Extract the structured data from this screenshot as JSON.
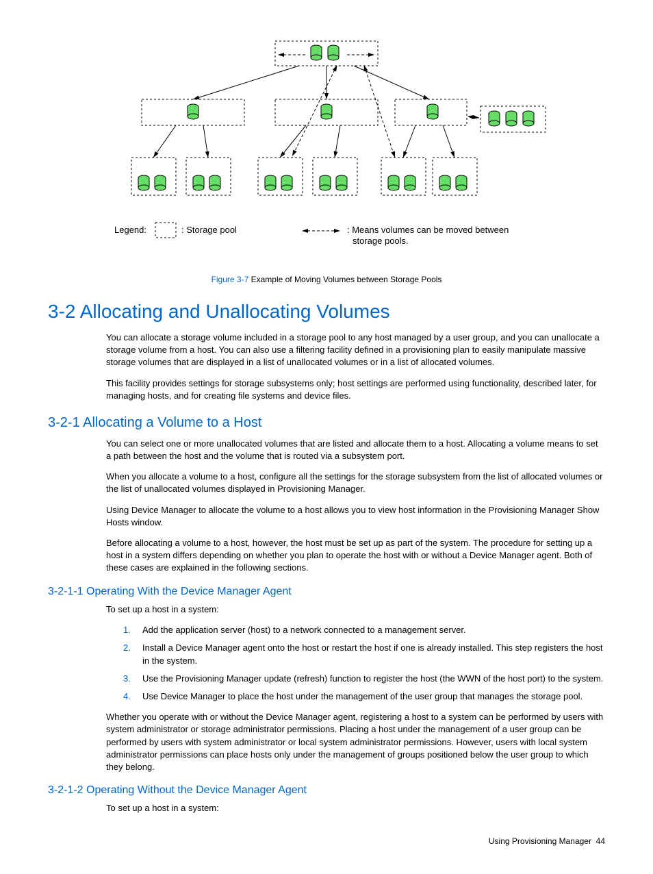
{
  "diagram": {
    "legend_label": "Legend:",
    "storage_pool_label": ": Storage pool",
    "arrow_label": ": Means volumes can be moved between storage pools."
  },
  "caption": {
    "fig": "Figure 3-7",
    "text": " Example of Moving Volumes between Storage Pools"
  },
  "h1": "3-2 Allocating and Unallocating Volumes",
  "p1": "You can allocate a storage volume included in a storage pool to any host managed by a user group, and you can unallocate a storage volume from a host. You can also use a filtering facility defined in a provisioning plan to easily manipulate massive storage volumes that are displayed in a list of unallocated volumes or in a list of allocated volumes.",
  "p2": "This facility provides settings for storage subsystems only; host settings are performed using functionality, described later, for managing hosts, and for creating file systems and device files.",
  "h2a": "3-2-1 Allocating a Volume to a Host",
  "p3": "You can select one or more unallocated volumes that are listed and allocate them to a host. Allocating a volume means to set a path between the host and the volume that is routed via a subsystem port.",
  "p4": "When you allocate a volume to a host, configure all the settings for the storage subsystem from the list of allocated volumes or the list of unallocated volumes displayed in Provisioning Manager.",
  "p5": "Using Device Manager to allocate the volume to a host allows you to view host information in the Provisioning Manager Show Hosts window.",
  "p6": "Before allocating a volume to a host, however, the host must be set up as part of the system. The procedure for setting up a host in a system differs depending on whether you plan to operate the host with or without a Device Manager agent. Both of these cases are explained in the following sections.",
  "h3a": "3-2-1-1 Operating With the Device Manager Agent",
  "p7": "To set up a host in a system:",
  "steps": [
    "Add the application server (host) to a network connected to a management server.",
    "Install a Device Manager agent onto the host or restart the host if one is already installed. This step registers the host in the system.",
    "Use the Provisioning Manager update (refresh) function to register the host (the WWN of the host port) to the system.",
    "Use Device Manager to place the host under the management of the user group that manages the storage pool."
  ],
  "p8": "Whether you operate with or without the Device Manager agent, registering a host to a system can be performed by users with system administrator or storage administrator permissions. Placing a host under the management of a user group can be performed by users with system administrator or local system administrator permissions. However, users with local system administrator permissions can place hosts only under the management of groups positioned below the user group to which they belong.",
  "h3b": "3-2-1-2 Operating Without the Device Manager Agent",
  "p9": "To set up a host in a system:",
  "footer": {
    "text": "Using Provisioning Manager",
    "page": "44"
  }
}
